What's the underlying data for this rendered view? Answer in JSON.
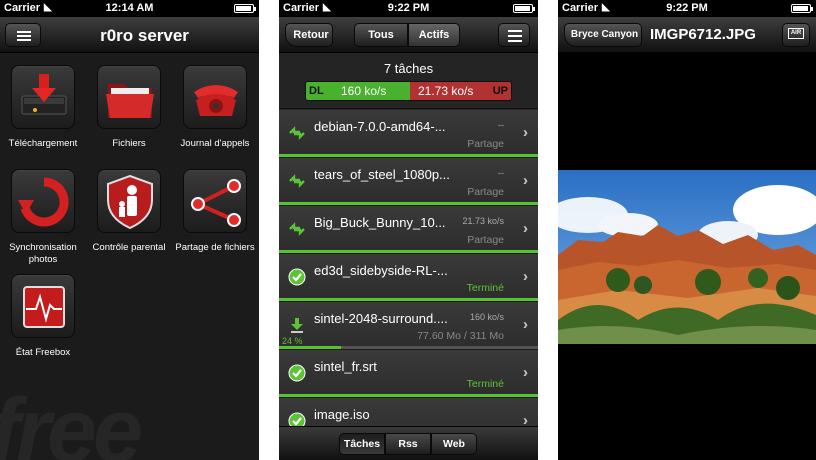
{
  "screen1": {
    "status": {
      "carrier": "Carrier",
      "time": "12:14 AM"
    },
    "title": "r0ro server",
    "items": [
      {
        "label": "Téléchargement",
        "icon": "download-icon"
      },
      {
        "label": "Fichiers",
        "icon": "folder-icon"
      },
      {
        "label": "Journal d'appels",
        "icon": "phone-icon"
      },
      {
        "label": "Synchronisation photos",
        "icon": "sync-icon"
      },
      {
        "label": "Contrôle parental",
        "icon": "parental-shield-icon"
      },
      {
        "label": "Partage de fichiers",
        "icon": "share-icon"
      },
      {
        "label": "État Freebox",
        "icon": "status-pulse-icon"
      }
    ]
  },
  "screen2": {
    "status": {
      "carrier": "Carrier",
      "time": "9:22 PM"
    },
    "back_label": "Retour",
    "segments": [
      "Tous",
      "Actifs"
    ],
    "summary": {
      "title": "7 tâches",
      "dl_label": "DL",
      "dl_speed": "160 ko/s",
      "up_speed": "21.73 ko/s",
      "up_label": "UP"
    },
    "rows": [
      {
        "name": "debian-7.0.0-amd64-...",
        "speed": "--",
        "status": "Partage",
        "type": "seed",
        "progress": 1.0
      },
      {
        "name": "tears_of_steel_1080p...",
        "speed": "--",
        "status": "Partage",
        "type": "seed",
        "progress": 1.0
      },
      {
        "name": "Big_Buck_Bunny_10...",
        "speed": "21.73 ko/s",
        "status": "Partage",
        "type": "seed",
        "progress": 1.0
      },
      {
        "name": "ed3d_sidebyside-RL-...",
        "speed": "",
        "status": "Terminé",
        "type": "done",
        "progress": 1.0
      },
      {
        "name": "sintel-2048-surround....",
        "speed": "160 ko/s",
        "status": "77.60 Mo / 311 Mo",
        "type": "download",
        "progress": 0.24,
        "percent": "24 %"
      },
      {
        "name": "sintel_fr.srt",
        "speed": "",
        "status": "Terminé",
        "type": "done",
        "progress": 1.0
      },
      {
        "name": "image.iso",
        "speed": "",
        "status": "",
        "type": "done",
        "progress": 1.0
      }
    ],
    "tabs": [
      "Tâches",
      "Rss",
      "Web"
    ]
  },
  "screen3": {
    "status": {
      "carrier": "Carrier",
      "time": "9:22 PM"
    },
    "back_label": "Bryce Canyon",
    "title": "IMGP6712.JPG",
    "airplay_label": "AIR"
  },
  "colors": {
    "download_green": "#4ab12e",
    "upload_red": "#b23131",
    "done_green": "#5bc434"
  }
}
